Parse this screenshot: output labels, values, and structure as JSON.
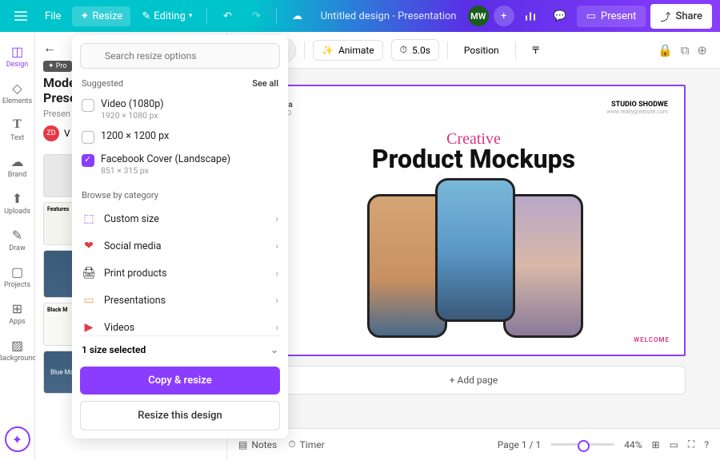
{
  "topbar": {
    "file": "File",
    "resize": "Resize",
    "editing": "Editing",
    "doc_title": "Untitled design - Presentation",
    "avatar": "MW",
    "present": "Present",
    "share": "Share"
  },
  "rail": {
    "items": [
      {
        "label": "Design",
        "icon": "🎨"
      },
      {
        "label": "Elements",
        "icon": "◇"
      },
      {
        "label": "Text",
        "icon": "T"
      },
      {
        "label": "Brand",
        "icon": "☁"
      },
      {
        "label": "Uploads",
        "icon": "⬆"
      },
      {
        "label": "Draw",
        "icon": "✎"
      },
      {
        "label": "Projects",
        "icon": "▢"
      },
      {
        "label": "Apps",
        "icon": "⊞"
      },
      {
        "label": "Background",
        "icon": "▨"
      }
    ]
  },
  "side": {
    "pro": "✦ Pro",
    "title1": "Mode",
    "title2": "Prese",
    "tag": "Presen",
    "creator_initials": "ZD",
    "creator_name": "V",
    "blue_mockups": "Blue Mockups"
  },
  "resize_panel": {
    "search_placeholder": "Search resize options",
    "suggested": "Suggested",
    "see_all": "See all",
    "options": [
      {
        "label": "Video (1080p)",
        "sub": "1920 × 1080 px",
        "checked": false
      },
      {
        "label": "1200 × 1200 px",
        "sub": "",
        "checked": false
      },
      {
        "label": "Facebook Cover (Landscape)",
        "sub": "851 × 315 px",
        "checked": true
      }
    ],
    "browse_label": "Browse by category",
    "categories": [
      {
        "label": "Custom size",
        "icon": "⬚",
        "color": "#8b3dff"
      },
      {
        "label": "Social media",
        "icon": "❤",
        "color": "#e63946"
      },
      {
        "label": "Print products",
        "icon": "🖨",
        "color": "#555"
      },
      {
        "label": "Presentations",
        "icon": "▭",
        "color": "#f4a261"
      },
      {
        "label": "Videos",
        "icon": "▶",
        "color": "#e63946"
      }
    ],
    "selected_text": "1 size selected",
    "primary": "Copy & resize",
    "secondary": "Resize this design"
  },
  "canvas_toolbar": {
    "animate": "Animate",
    "duration": "5.0s",
    "position": "Position"
  },
  "slide": {
    "author_name": "rcia",
    "author_role": "CEO",
    "studio": "STUDIO SHODWE",
    "url": "www.reallygreatsite.com",
    "script": "Creative",
    "heading": "Product Mockups",
    "welcome": "WELCOME"
  },
  "add_page": "+ Add page",
  "bottombar": {
    "notes": "Notes",
    "timer": "Timer",
    "page": "Page 1 / 1",
    "zoom": "44%"
  }
}
